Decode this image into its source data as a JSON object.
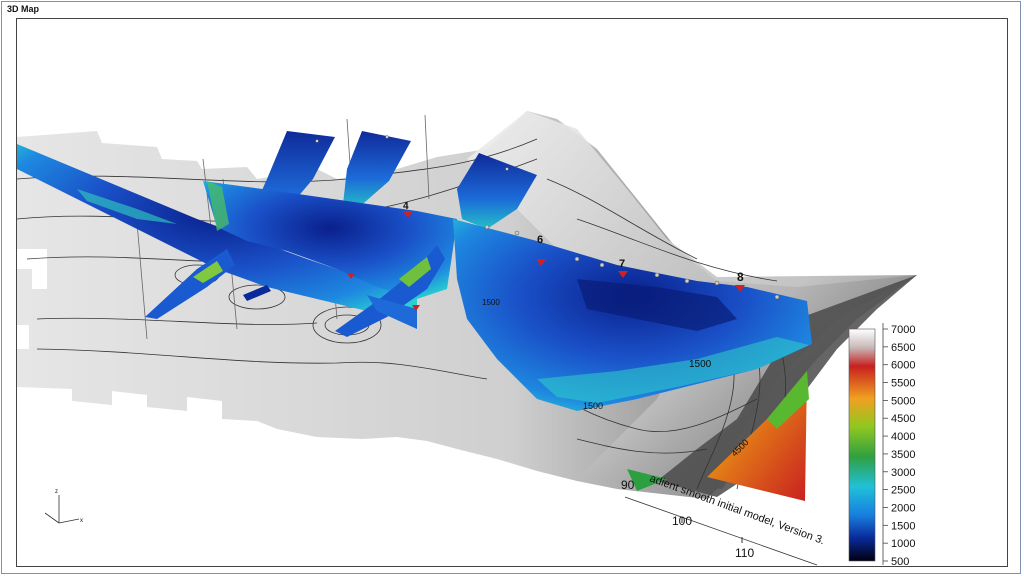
{
  "window": {
    "title": "3D Map"
  },
  "colors": {
    "frame_border": "#7f8fb0",
    "terrain_light": "#e8e8e8",
    "terrain_dark": "#5a5a5a",
    "section_deep": "#0a2aa0",
    "section_mid": "#1e6ce0",
    "section_cyan": "#2ad0d0",
    "marker_red": "#d02020"
  },
  "markers": [
    "4",
    "6",
    "7",
    "8"
  ],
  "contour_labels": [
    "1500",
    "1500",
    "1500",
    "4500"
  ],
  "axis": {
    "title": "adient smooth initial model, Version 3.",
    "ticks": [
      "90",
      "100",
      "110"
    ]
  },
  "orientation": {
    "z": "z",
    "x": "x"
  },
  "legend": {
    "values": [
      "7000",
      "6500",
      "6000",
      "5500",
      "5000",
      "4500",
      "4000",
      "3500",
      "3000",
      "2500",
      "2000",
      "1500",
      "1000",
      "500"
    ],
    "colors": [
      "#ffffff",
      "#c8b8b8",
      "#c82020",
      "#e05018",
      "#f0a020",
      "#e8d020",
      "#90c820",
      "#30a040",
      "#20b0a0",
      "#20c0d8",
      "#1880e0",
      "#1040c0",
      "#081a70",
      "#02051a"
    ]
  }
}
